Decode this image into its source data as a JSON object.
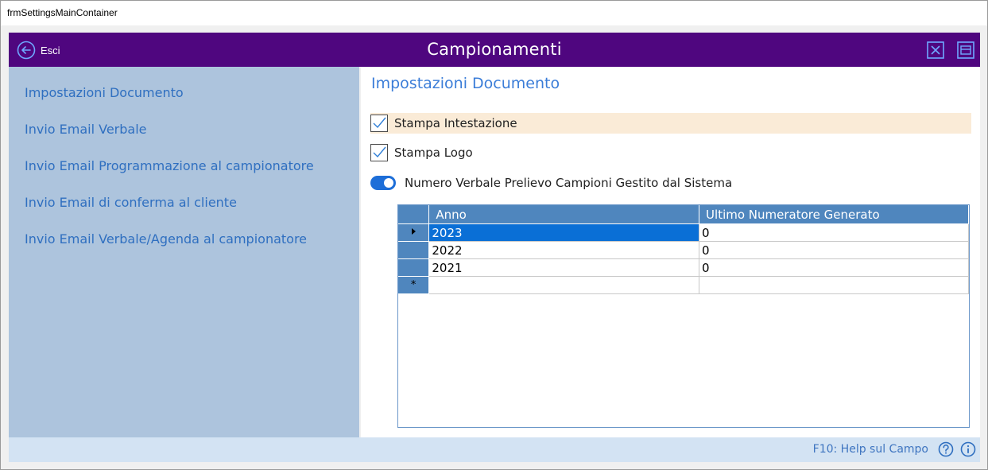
{
  "window": {
    "title": "frmSettingsMainContainer"
  },
  "header": {
    "exit_label": "Esci",
    "title": "Campionamenti",
    "bg_color": "#4f067f"
  },
  "sidebar": {
    "items": [
      {
        "label": "Impostazioni Documento"
      },
      {
        "label": "Invio Email Verbale"
      },
      {
        "label": "Invio Email Programmazione al campionatore"
      },
      {
        "label": "Invio Email di conferma al cliente"
      },
      {
        "label": "Invio Email Verbale/Agenda al campionatore"
      }
    ]
  },
  "main": {
    "title": "Impostazioni Documento",
    "options": [
      {
        "label": "Stampa Intestazione",
        "checked": true
      },
      {
        "label": "Stampa Logo",
        "checked": true
      }
    ],
    "toggle": {
      "label": "Numero Verbale Prelievo Campioni Gestito dal Sistema",
      "on": true
    },
    "grid": {
      "columns": [
        "Anno",
        "Ultimo Numeratore Generato"
      ],
      "rows": [
        [
          "2023",
          "0"
        ],
        [
          "2022",
          "0"
        ],
        [
          "2021",
          "0"
        ]
      ],
      "new_row_marker": "*"
    }
  },
  "status": {
    "help_text": "F10: Help sul Campo"
  }
}
